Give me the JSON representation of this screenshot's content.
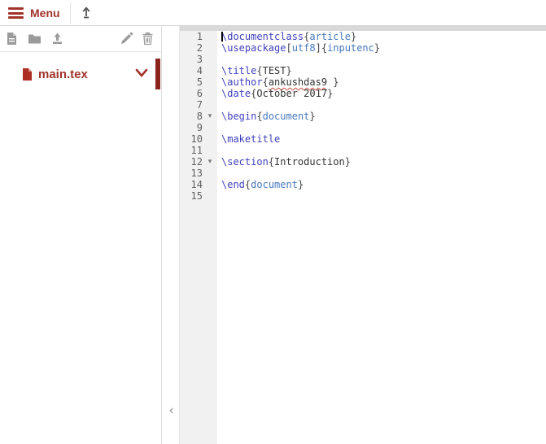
{
  "colors": {
    "accent_maroon": "#a0342b",
    "sidebar_scrollbar_thumb": "#8b241c",
    "code_command": "#3f3fbd",
    "code_argument": "#4779bd",
    "code_text": "#333333",
    "gutter_background": "#f1f1f1"
  },
  "toolbar": {
    "menu_label": "Menu",
    "icons": {
      "menu": "hamburger-icon",
      "publish": "publish-up-arrow-icon"
    }
  },
  "sidebar": {
    "toolbar_icons": [
      "new-file-icon",
      "new-folder-icon",
      "upload-icon",
      "pencil-icon",
      "trash-icon"
    ],
    "files": [
      {
        "name": "main.tex",
        "icon": "tex-file-icon",
        "expander": "chevron-down-icon"
      }
    ]
  },
  "resizer": {
    "collapse_glyph": "‹"
  },
  "editor": {
    "cursor_line": 1,
    "fold_glyph": "▾",
    "lines": [
      {
        "n": 1,
        "fold": false,
        "tokens": [
          [
            "cmd",
            "\\documentclass"
          ],
          [
            "brc",
            "{"
          ],
          [
            "arg",
            "article"
          ],
          [
            "brc",
            "}"
          ]
        ]
      },
      {
        "n": 2,
        "fold": false,
        "tokens": [
          [
            "cmd",
            "\\usepackage"
          ],
          [
            "brc",
            "["
          ],
          [
            "arg",
            "utf8"
          ],
          [
            "brc",
            "]{"
          ],
          [
            "arg",
            "inputenc"
          ],
          [
            "brc",
            "}"
          ]
        ]
      },
      {
        "n": 3,
        "fold": false,
        "tokens": []
      },
      {
        "n": 4,
        "fold": false,
        "tokens": [
          [
            "cmd",
            "\\title"
          ],
          [
            "brc",
            "{"
          ],
          [
            "txt",
            "TEST"
          ],
          [
            "brc",
            "}"
          ]
        ]
      },
      {
        "n": 5,
        "fold": false,
        "tokens": [
          [
            "cmd",
            "\\author"
          ],
          [
            "brc",
            "{"
          ],
          [
            "sp",
            "ankushdas9"
          ],
          [
            "txt",
            " "
          ],
          [
            "brc",
            "}"
          ]
        ]
      },
      {
        "n": 6,
        "fold": false,
        "tokens": [
          [
            "cmd",
            "\\date"
          ],
          [
            "brc",
            "{"
          ],
          [
            "txt",
            "October 2017"
          ],
          [
            "brc",
            "}"
          ]
        ]
      },
      {
        "n": 7,
        "fold": false,
        "tokens": []
      },
      {
        "n": 8,
        "fold": true,
        "tokens": [
          [
            "cmd",
            "\\begin"
          ],
          [
            "brc",
            "{"
          ],
          [
            "arg",
            "document"
          ],
          [
            "brc",
            "}"
          ]
        ]
      },
      {
        "n": 9,
        "fold": false,
        "tokens": []
      },
      {
        "n": 10,
        "fold": false,
        "tokens": [
          [
            "cmd",
            "\\maketitle"
          ]
        ]
      },
      {
        "n": 11,
        "fold": false,
        "tokens": []
      },
      {
        "n": 12,
        "fold": true,
        "tokens": [
          [
            "cmd",
            "\\section"
          ],
          [
            "brc",
            "{"
          ],
          [
            "txt",
            "Introduction"
          ],
          [
            "brc",
            "}"
          ]
        ]
      },
      {
        "n": 13,
        "fold": false,
        "tokens": []
      },
      {
        "n": 14,
        "fold": false,
        "tokens": [
          [
            "cmd",
            "\\end"
          ],
          [
            "brc",
            "{"
          ],
          [
            "arg",
            "document"
          ],
          [
            "brc",
            "}"
          ]
        ]
      },
      {
        "n": 15,
        "fold": false,
        "tokens": []
      }
    ]
  }
}
